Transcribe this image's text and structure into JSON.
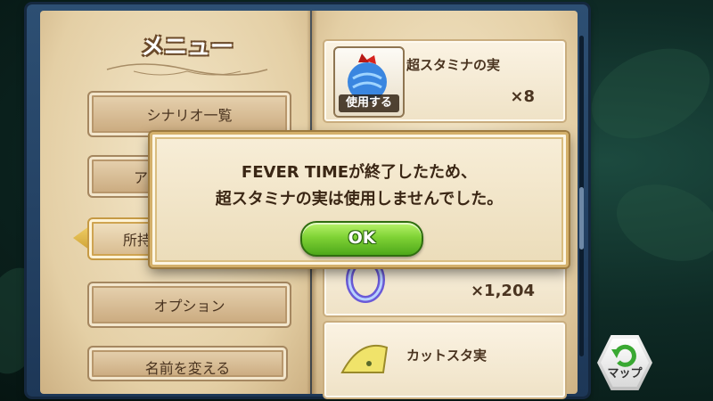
{
  "menu": {
    "title": "メニュー",
    "items": [
      {
        "label": "シナリオ一覧"
      },
      {
        "label": "ア"
      },
      {
        "label": "所持"
      },
      {
        "label": "オプション"
      },
      {
        "label": "名前を変える"
      }
    ]
  },
  "items_list": [
    {
      "name": "超スタミナの実",
      "count": "×8",
      "use_label": "使用する"
    },
    {
      "name": "",
      "count": "×1,204"
    },
    {
      "name": "カットスタ実",
      "count": ""
    }
  ],
  "dialog": {
    "line1": "FEVER TIMEが終了したため、",
    "line2": "超スタミナの実は使用しませんでした。",
    "ok_label": "OK"
  },
  "map_button": {
    "label": "マップ"
  }
}
